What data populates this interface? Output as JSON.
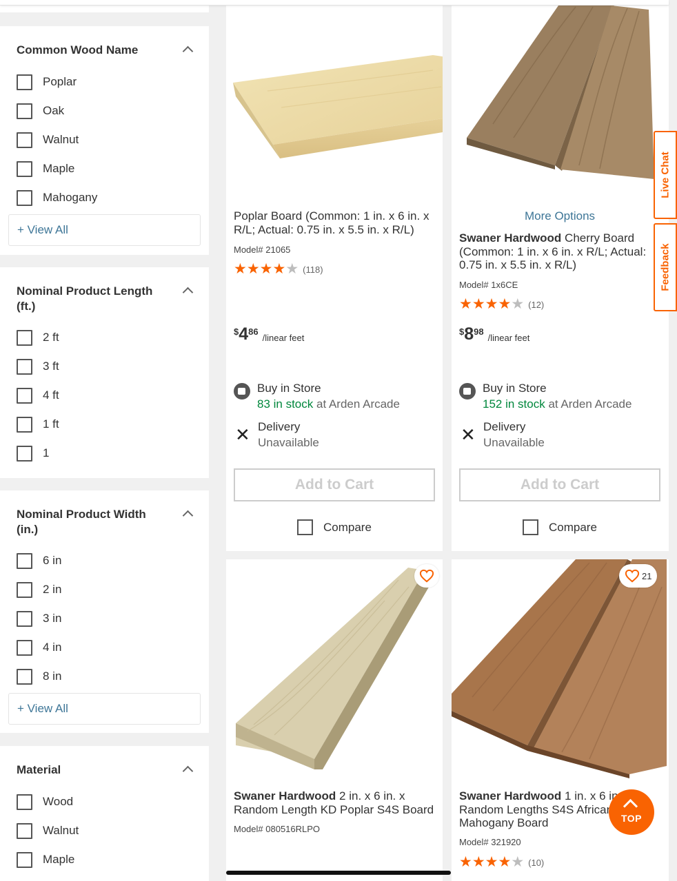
{
  "filters": [
    {
      "title": "Common Wood Name",
      "options": [
        "Poplar",
        "Oak",
        "Walnut",
        "Maple",
        "Mahogany"
      ],
      "view_all": "+ View All"
    },
    {
      "title": "Nominal Product Length (ft.)",
      "options": [
        "2 ft",
        "3 ft",
        "4 ft",
        "1 ft",
        "1"
      ]
    },
    {
      "title": "Nominal Product Width (in.)",
      "options": [
        "6 in",
        "2 in",
        "3 in",
        "4 in",
        "8 in"
      ],
      "view_all": "+ View All"
    },
    {
      "title": "Material",
      "options": [
        "Wood",
        "Walnut",
        "Maple"
      ]
    }
  ],
  "products": [
    {
      "brand": "",
      "title": "Poplar Board (Common: 1 in. x 6 in. x R/L; Actual: 0.75 in. x 5.5 in. x R/L)",
      "model": "Model# 21065",
      "rating": 4.5,
      "reviews": "(118)",
      "price_cur": "$",
      "price_dollars": "4",
      "price_cents": "86",
      "price_unit": "/linear feet",
      "store_label": "Buy in Store",
      "stock": "83 in stock",
      "store_suffix": " at Arden Arcade",
      "delivery_label": "Delivery",
      "delivery_status": "Unavailable",
      "add_to_cart": "Add to Cart",
      "compare": "Compare"
    },
    {
      "more_options": "More Options",
      "brand": "Swaner Hardwood",
      "title": " Cherry Board (Common: 1 in. x 6 in. x R/L; Actual: 0.75 in. x 5.5 in. x R/L)",
      "model": "Model# 1x6CE",
      "rating": 4.5,
      "reviews": "(12)",
      "price_cur": "$",
      "price_dollars": "8",
      "price_cents": "98",
      "price_unit": "/linear feet",
      "store_label": "Buy in Store",
      "stock": "152 in stock",
      "store_suffix": " at Arden Arcade",
      "delivery_label": "Delivery",
      "delivery_status": "Unavailable",
      "add_to_cart": "Add to Cart",
      "compare": "Compare"
    },
    {
      "brand": "Swaner Hardwood",
      "title": " 2 in. x 6 in. x Random Length KD Poplar S4S Board",
      "model": "Model# 080516RLPO"
    },
    {
      "brand": "Swaner Hardwood",
      "title": " 1 in. x 6 in. x Random Lengths S4S African Mahogany Board",
      "model": "Model# 321920",
      "rating": 4.5,
      "reviews": "(10)",
      "favorites": "21"
    }
  ],
  "side_tabs": {
    "live_chat": "Live Chat",
    "feedback": "Feedback"
  },
  "top_button": "TOP",
  "colors": {
    "brand_orange": "#f96302",
    "link_blue": "#3e7697",
    "stock_green": "#00873c"
  }
}
